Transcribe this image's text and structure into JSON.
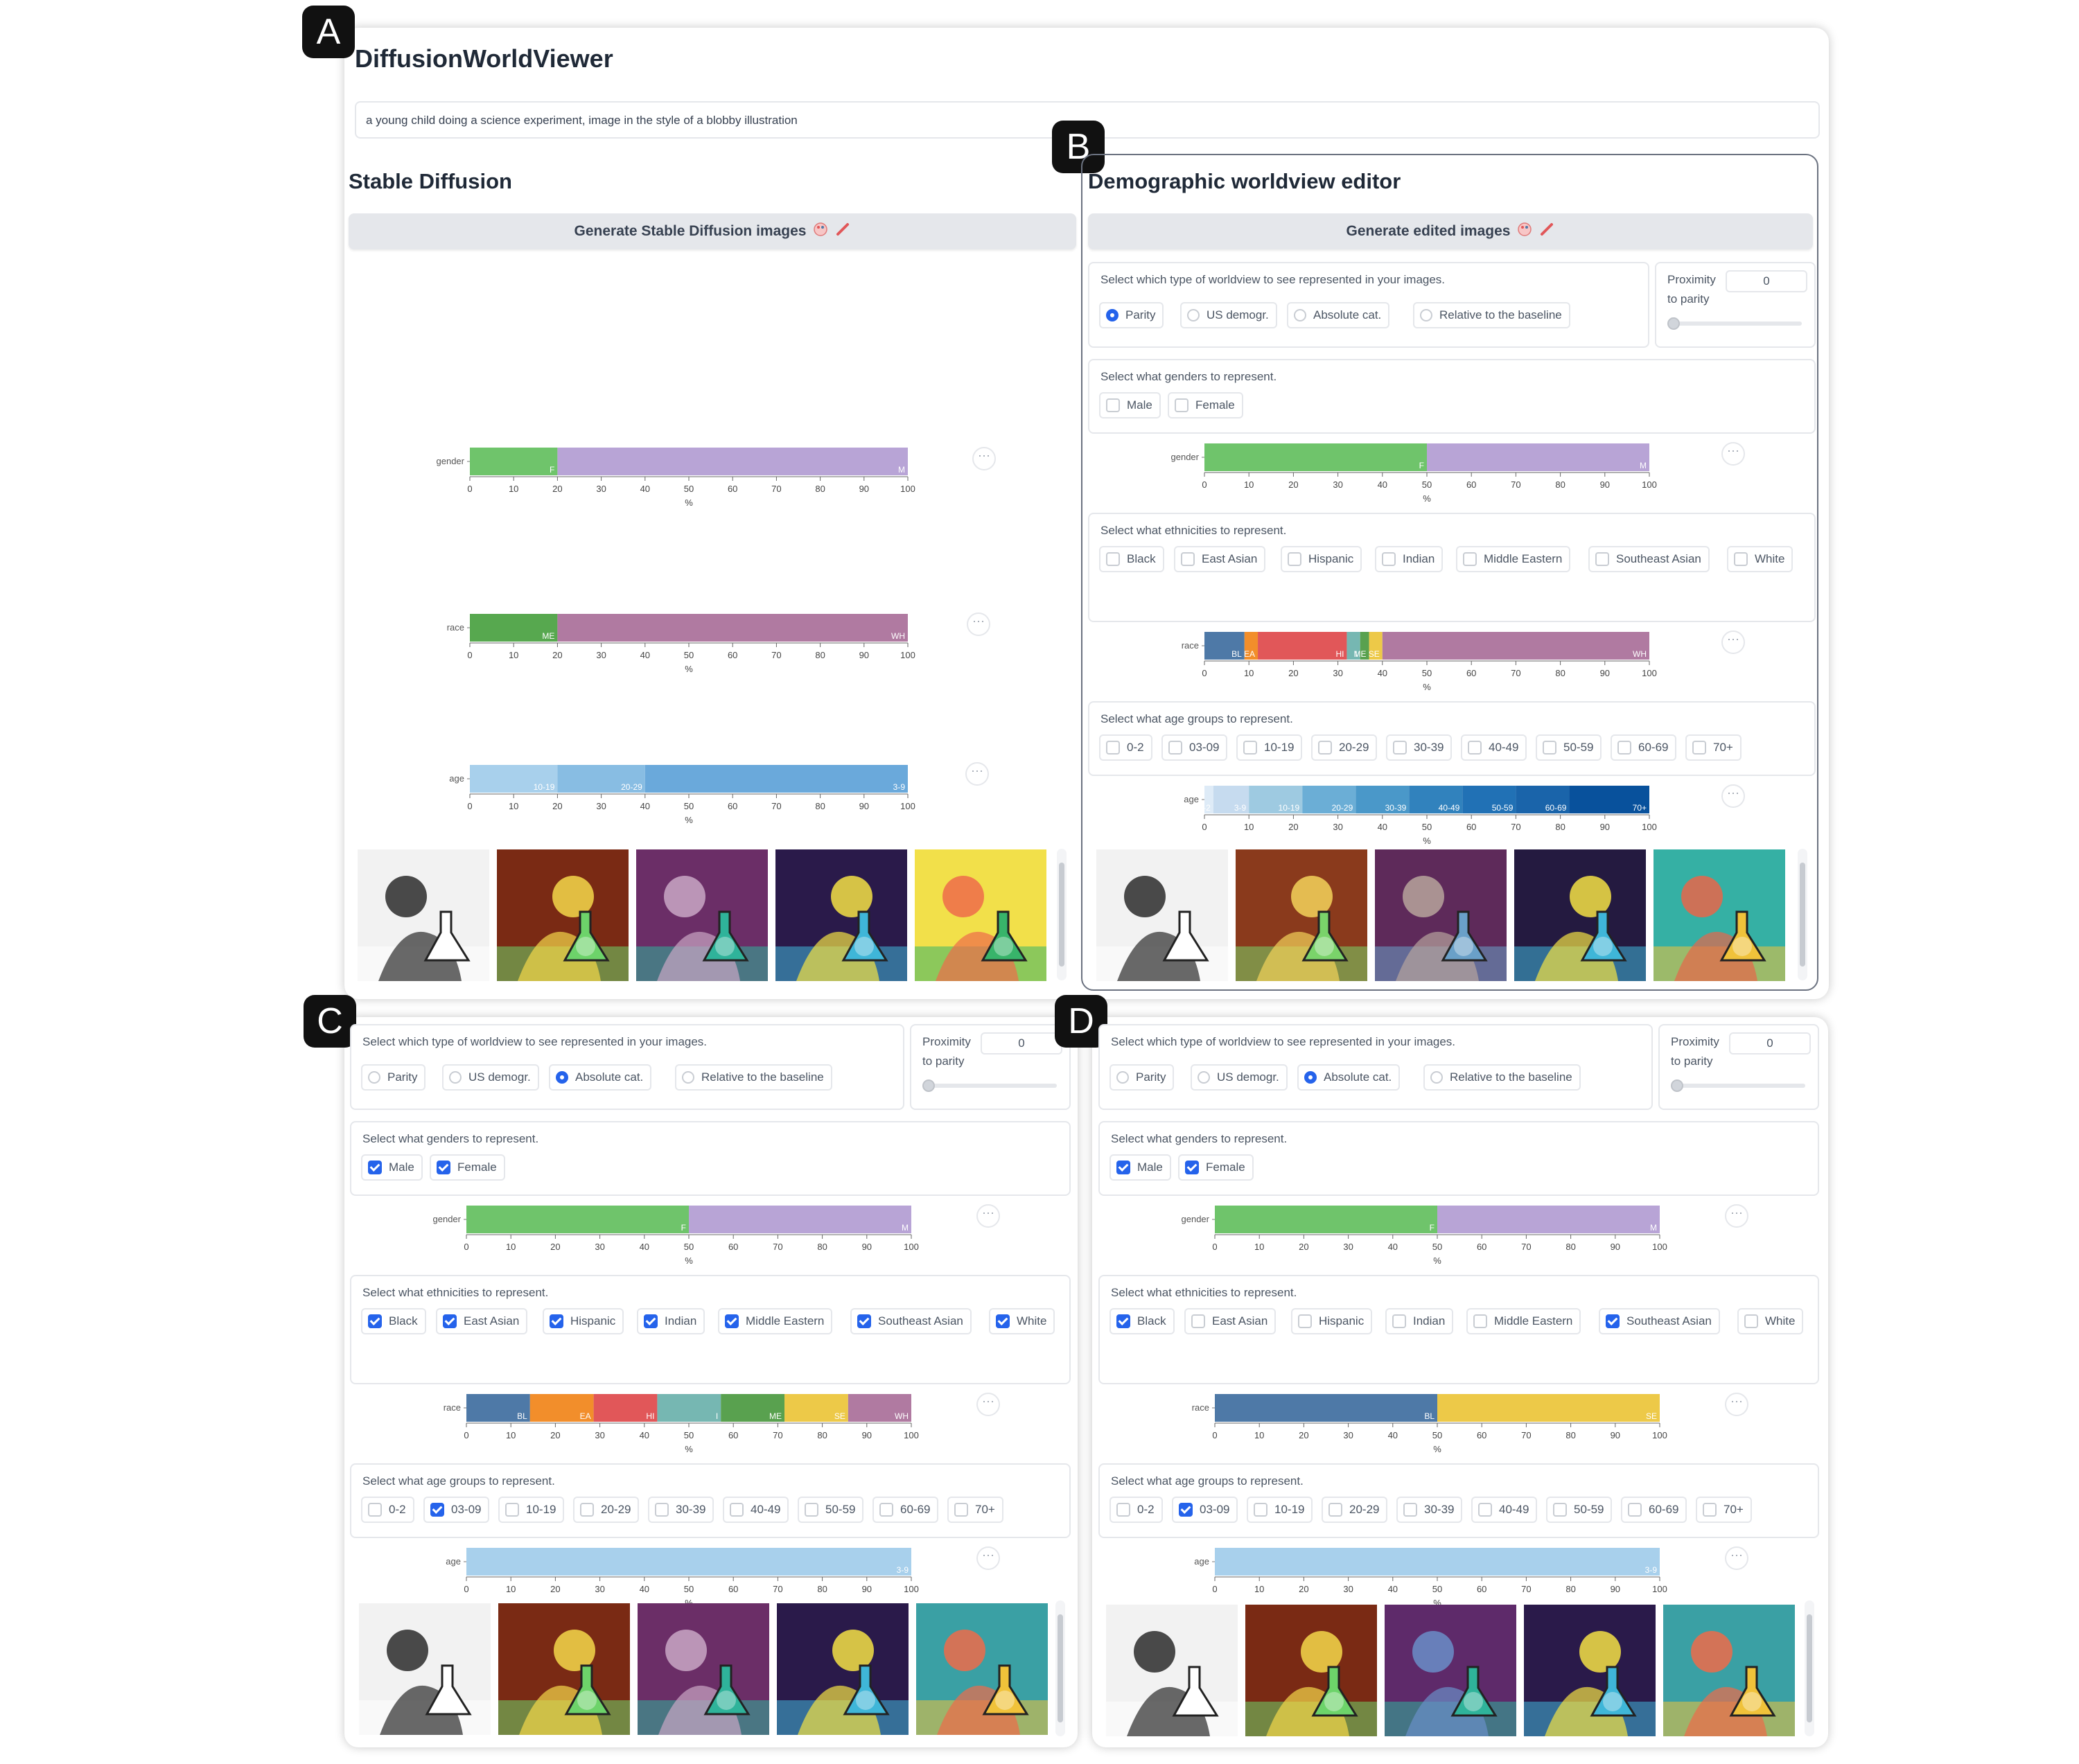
{
  "badges": [
    "A",
    "B",
    "C",
    "D"
  ],
  "app": {
    "title": "DiffusionWorldViewer",
    "prompt": "a young child doing a  science experiment, image in the style of a blobby illustration"
  },
  "stable": {
    "title": "Stable Diffusion",
    "button": "Generate Stable Diffusion images",
    "button_icons": [
      "palette-icon",
      "brush-icon"
    ]
  },
  "editor": {
    "title": "Demographic worldview editor",
    "button": "Generate edited images"
  },
  "controls": {
    "worldview_label": "Select which type of worldview to see represented in your images.",
    "worldview_options": [
      "Parity",
      "US demogr.",
      "Absolute cat.",
      "Relative to the baseline"
    ],
    "proximity_label": "Proximity",
    "proximity_label2": "to parity",
    "proximity_value": "0",
    "genders_label": "Select what genders to represent.",
    "gender_options": [
      "Male",
      "Female"
    ],
    "ethnicities_label": "Select what ethnicities to represent.",
    "ethnicity_options": [
      "Black",
      "East Asian",
      "Hispanic",
      "Indian",
      "Middle Eastern",
      "Southeast Asian",
      "White"
    ],
    "ages_label": "Select what age groups to represent.",
    "age_options": [
      "0-2",
      "03-09",
      "10-19",
      "20-29",
      "30-39",
      "40-49",
      "50-59",
      "60-69",
      "70+"
    ],
    "more_icon": "···"
  },
  "panels": {
    "B": {
      "worldview": "Parity",
      "genders": [],
      "ethnicities": [],
      "ages": [],
      "proximity": 0
    },
    "C": {
      "worldview": "Absolute cat.",
      "genders": [
        "Male",
        "Female"
      ],
      "ethnicities": [
        "Black",
        "East Asian",
        "Hispanic",
        "Indian",
        "Middle Eastern",
        "Southeast Asian",
        "White"
      ],
      "ages": [
        "03-09"
      ],
      "proximity": 0
    },
    "D": {
      "worldview": "Absolute cat.",
      "genders": [
        "Male",
        "Female"
      ],
      "ethnicities": [
        "Black",
        "Southeast Asian"
      ],
      "ages": [
        "03-09"
      ],
      "proximity": 0
    }
  },
  "colors": {
    "accent": "#2563eb",
    "female": "#6fc46b",
    "male": "#b8a4d6",
    "age_light": "#a8d0ec"
  },
  "chart_data": [
    {
      "id": "A-gender",
      "type": "bar",
      "ylabel": "gender",
      "xlabel": "%",
      "xlim": [
        0,
        100
      ],
      "ticks": [
        0,
        10,
        20,
        30,
        40,
        50,
        60,
        70,
        80,
        90,
        100
      ],
      "series": [
        {
          "label": "F",
          "value": 20,
          "color": "#6fc46b"
        },
        {
          "label": "M",
          "value": 80,
          "color": "#b8a4d6"
        }
      ]
    },
    {
      "id": "A-race",
      "type": "bar",
      "ylabel": "race",
      "xlabel": "%",
      "xlim": [
        0,
        100
      ],
      "ticks": [
        0,
        10,
        20,
        30,
        40,
        50,
        60,
        70,
        80,
        90,
        100
      ],
      "series": [
        {
          "label": "ME",
          "value": 20,
          "color": "#57a84f"
        },
        {
          "label": "WH",
          "value": 80,
          "color": "#b07aa1"
        }
      ]
    },
    {
      "id": "A-age",
      "type": "bar",
      "ylabel": "age",
      "xlabel": "%",
      "xlim": [
        0,
        100
      ],
      "ticks": [
        0,
        10,
        20,
        30,
        40,
        50,
        60,
        70,
        80,
        90,
        100
      ],
      "series": [
        {
          "label": "10-19",
          "value": 20,
          "color": "#a8d0ec"
        },
        {
          "label": "20-29",
          "value": 20,
          "color": "#88bde3"
        },
        {
          "label": "3-9",
          "value": 60,
          "color": "#6aa9db"
        }
      ]
    },
    {
      "id": "B-gender",
      "type": "bar",
      "ylabel": "gender",
      "xlabel": "%",
      "xlim": [
        0,
        100
      ],
      "ticks": [
        0,
        10,
        20,
        30,
        40,
        50,
        60,
        70,
        80,
        90,
        100
      ],
      "series": [
        {
          "label": "F",
          "value": 50,
          "color": "#6fc46b"
        },
        {
          "label": "M",
          "value": 50,
          "color": "#b8a4d6"
        }
      ]
    },
    {
      "id": "B-race",
      "type": "bar",
      "ylabel": "race",
      "xlabel": "%",
      "xlim": [
        0,
        100
      ],
      "ticks": [
        0,
        10,
        20,
        30,
        40,
        50,
        60,
        70,
        80,
        90,
        100
      ],
      "series": [
        {
          "label": "BL",
          "value": 9,
          "color": "#4e79a7"
        },
        {
          "label": "EA",
          "value": 3,
          "color": "#f28e2b"
        },
        {
          "label": "HI",
          "value": 20,
          "color": "#e15759"
        },
        {
          "label": "I",
          "value": 3,
          "color": "#76b7b2"
        },
        {
          "label": "ME",
          "value": 2,
          "color": "#59a14f"
        },
        {
          "label": "SE",
          "value": 3,
          "color": "#edc948"
        },
        {
          "label": "WH",
          "value": 60,
          "color": "#b07aa1"
        }
      ]
    },
    {
      "id": "B-age",
      "type": "bar",
      "ylabel": "age",
      "xlabel": "%",
      "xlim": [
        0,
        100
      ],
      "ticks": [
        0,
        10,
        20,
        30,
        40,
        50,
        60,
        70,
        80,
        90,
        100
      ],
      "series": [
        {
          "label": "0-2",
          "value": 2,
          "color": "#deebf7"
        },
        {
          "label": "3-9",
          "value": 8,
          "color": "#c6dbef"
        },
        {
          "label": "10-19",
          "value": 12,
          "color": "#9ecae1"
        },
        {
          "label": "20-29",
          "value": 12,
          "color": "#6baed6"
        },
        {
          "label": "30-39",
          "value": 12,
          "color": "#4a98c9"
        },
        {
          "label": "40-49",
          "value": 12,
          "color": "#3182bd"
        },
        {
          "label": "50-59",
          "value": 12,
          "color": "#2171b5"
        },
        {
          "label": "60-69",
          "value": 12,
          "color": "#1a64aa"
        },
        {
          "label": "70+",
          "value": 18,
          "color": "#08519c"
        }
      ]
    },
    {
      "id": "C-gender",
      "type": "bar",
      "ylabel": "gender",
      "xlabel": "%",
      "xlim": [
        0,
        100
      ],
      "ticks": [
        0,
        10,
        20,
        30,
        40,
        50,
        60,
        70,
        80,
        90,
        100
      ],
      "series": [
        {
          "label": "F",
          "value": 50,
          "color": "#6fc46b"
        },
        {
          "label": "M",
          "value": 50,
          "color": "#b8a4d6"
        }
      ]
    },
    {
      "id": "C-race",
      "type": "bar",
      "ylabel": "race",
      "xlabel": "%",
      "xlim": [
        0,
        100
      ],
      "ticks": [
        0,
        10,
        20,
        30,
        40,
        50,
        60,
        70,
        80,
        90,
        100
      ],
      "series": [
        {
          "label": "BL",
          "value": 14.3,
          "color": "#4e79a7"
        },
        {
          "label": "EA",
          "value": 14.3,
          "color": "#f28e2b"
        },
        {
          "label": "HI",
          "value": 14.3,
          "color": "#e15759"
        },
        {
          "label": "I",
          "value": 14.3,
          "color": "#76b7b2"
        },
        {
          "label": "ME",
          "value": 14.3,
          "color": "#59a14f"
        },
        {
          "label": "SE",
          "value": 14.3,
          "color": "#edc948"
        },
        {
          "label": "WH",
          "value": 14.2,
          "color": "#b07aa1"
        }
      ]
    },
    {
      "id": "C-age",
      "type": "bar",
      "ylabel": "age",
      "xlabel": "%",
      "xlim": [
        0,
        100
      ],
      "ticks": [
        0,
        10,
        20,
        30,
        40,
        50,
        60,
        70,
        80,
        90,
        100
      ],
      "series": [
        {
          "label": "3-9",
          "value": 100,
          "color": "#a8d0ec"
        }
      ]
    },
    {
      "id": "D-gender",
      "type": "bar",
      "ylabel": "gender",
      "xlabel": "%",
      "xlim": [
        0,
        100
      ],
      "ticks": [
        0,
        10,
        20,
        30,
        40,
        50,
        60,
        70,
        80,
        90,
        100
      ],
      "series": [
        {
          "label": "F",
          "value": 50,
          "color": "#6fc46b"
        },
        {
          "label": "M",
          "value": 50,
          "color": "#b8a4d6"
        }
      ]
    },
    {
      "id": "D-race",
      "type": "bar",
      "ylabel": "race",
      "xlabel": "%",
      "xlim": [
        0,
        100
      ],
      "ticks": [
        0,
        10,
        20,
        30,
        40,
        50,
        60,
        70,
        80,
        90,
        100
      ],
      "series": [
        {
          "label": "BL",
          "value": 50,
          "color": "#4e79a7"
        },
        {
          "label": "SE",
          "value": 50,
          "color": "#edc948"
        }
      ]
    },
    {
      "id": "D-age",
      "type": "bar",
      "ylabel": "age",
      "xlabel": "%",
      "xlim": [
        0,
        100
      ],
      "ticks": [
        0,
        10,
        20,
        30,
        40,
        50,
        60,
        70,
        80,
        90,
        100
      ],
      "series": [
        {
          "label": "3-9",
          "value": 100,
          "color": "#a8d0ec"
        }
      ]
    }
  ],
  "image_rows": {
    "A": [
      {
        "bg": "#f2f2f2",
        "fg": "#2b2b2b",
        "acc": "#ffffff"
      },
      {
        "bg": "#7a2a14",
        "fg": "#f5d84a",
        "acc": "#6dd36a"
      },
      {
        "bg": "#6b2e67",
        "fg": "#c9a7c5",
        "acc": "#2fb39a"
      },
      {
        "bg": "#2a1a4a",
        "fg": "#f4e245",
        "acc": "#3fb6d8"
      },
      {
        "bg": "#f2e04a",
        "fg": "#ee6b4a",
        "acc": "#38b46a"
      }
    ],
    "B": [
      {
        "bg": "#f2f2f2",
        "fg": "#2b2b2b",
        "acc": "#ffffff"
      },
      {
        "bg": "#8a3a1c",
        "fg": "#f3d35a",
        "acc": "#7ad36a"
      },
      {
        "bg": "#5e2a5a",
        "fg": "#b7a49c",
        "acc": "#6aa0c8"
      },
      {
        "bg": "#241a40",
        "fg": "#f4e245",
        "acc": "#3fb6d8"
      },
      {
        "bg": "#35b0a4",
        "fg": "#e7664a",
        "acc": "#f0c23a"
      }
    ],
    "C": [
      {
        "bg": "#f2f2f2",
        "fg": "#2b2b2b",
        "acc": "#ffffff"
      },
      {
        "bg": "#7a2a14",
        "fg": "#f5d84a",
        "acc": "#6dd36a"
      },
      {
        "bg": "#6b2e67",
        "fg": "#c9a7c5",
        "acc": "#2fb39a"
      },
      {
        "bg": "#2a1a4a",
        "fg": "#f4e245",
        "acc": "#3fb6d8"
      },
      {
        "bg": "#3aa0a4",
        "fg": "#ee6b4a",
        "acc": "#f0c23a"
      }
    ],
    "D": [
      {
        "bg": "#f2f2f2",
        "fg": "#2b2b2b",
        "acc": "#ffffff"
      },
      {
        "bg": "#7a2a14",
        "fg": "#f5d84a",
        "acc": "#6dd36a"
      },
      {
        "bg": "#5e2a6a",
        "fg": "#6a8ec8",
        "acc": "#2fb39a"
      },
      {
        "bg": "#2a1a4a",
        "fg": "#f4e245",
        "acc": "#3fb6d8"
      },
      {
        "bg": "#3aa0a4",
        "fg": "#ee6b4a",
        "acc": "#f0c23a"
      }
    ]
  }
}
